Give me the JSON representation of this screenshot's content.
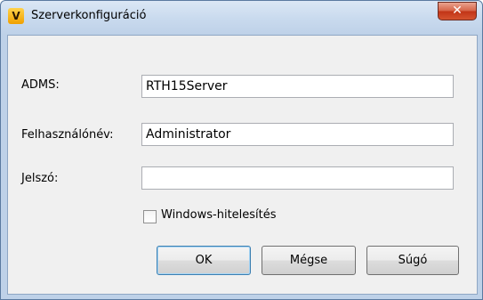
{
  "window": {
    "title": "Szerverkonfiguráció",
    "app_icon_glyph": "V",
    "close_glyph": "✕"
  },
  "form": {
    "adms_label": "ADMS:",
    "adms_value": "RTH15Server",
    "username_label": "Felhasználónév:",
    "username_value": "Administrator",
    "password_label": "Jelszó:",
    "password_value": "",
    "windows_auth_label": "Windows-hitelesítés",
    "windows_auth_checked": false
  },
  "buttons": {
    "ok": "OK",
    "cancel": "Mégse",
    "help": "Súgó"
  },
  "colors": {
    "titlebar": "#c9daee",
    "close": "#c23417",
    "default_button_border": "#3c7fb1"
  }
}
